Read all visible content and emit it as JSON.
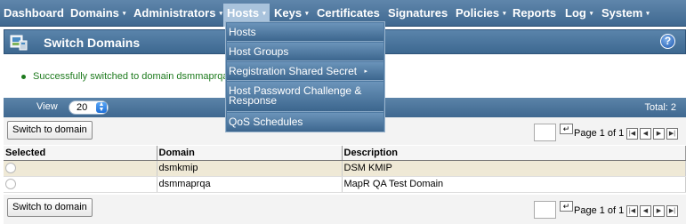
{
  "nav": {
    "items": [
      {
        "label": "Dashboard",
        "caret": ""
      },
      {
        "label": "Domains",
        "caret": "▾"
      },
      {
        "label": "Administrators",
        "caret": "▾"
      },
      {
        "label": "Hosts",
        "caret": "▾"
      },
      {
        "label": "Keys",
        "caret": "▾"
      },
      {
        "label": "Certificates",
        "caret": ""
      },
      {
        "label": "Signatures",
        "caret": ""
      },
      {
        "label": "Policies",
        "caret": "▾"
      },
      {
        "label": "Reports",
        "caret": ""
      },
      {
        "label": "Log",
        "caret": "▾"
      },
      {
        "label": "System",
        "caret": "▾"
      }
    ],
    "active": "Hosts"
  },
  "header": {
    "title": "Switch Domains",
    "help_label": "?",
    "icon": "switch-domains-icon"
  },
  "message": {
    "text": "Successfully switched to domain dsmmaprqa."
  },
  "view_bar": {
    "label": "View",
    "page_size": "20",
    "total": "Total: 2"
  },
  "actions": {
    "switch_label": "Switch to domain",
    "go_label": "↵",
    "page_text": "Page 1 of 1",
    "pager": [
      "|◀",
      "◀",
      "▶",
      "▶|"
    ]
  },
  "table": {
    "columns": [
      "Selected",
      "Domain",
      "Description"
    ],
    "rows": [
      {
        "domain": "dsmkmip",
        "description": "DSM KMIP"
      },
      {
        "domain": "dsmmaprqa",
        "description": "MapR QA Test Domain"
      }
    ]
  },
  "hosts_menu": {
    "items": [
      {
        "label": "Hosts",
        "has_sub": false
      },
      {
        "label": "Host Groups",
        "has_sub": false
      },
      {
        "label": "Registration Shared Secret",
        "has_sub": true
      },
      {
        "label": "Host Password Challenge & Response",
        "has_sub": false
      },
      {
        "label": "QoS Schedules",
        "has_sub": false
      }
    ],
    "submenu_marker": "▸"
  },
  "colors": {
    "nav_bg": "#4f77a0",
    "message_green": "#1d7a1d",
    "selected_row": "#efe9d6"
  }
}
